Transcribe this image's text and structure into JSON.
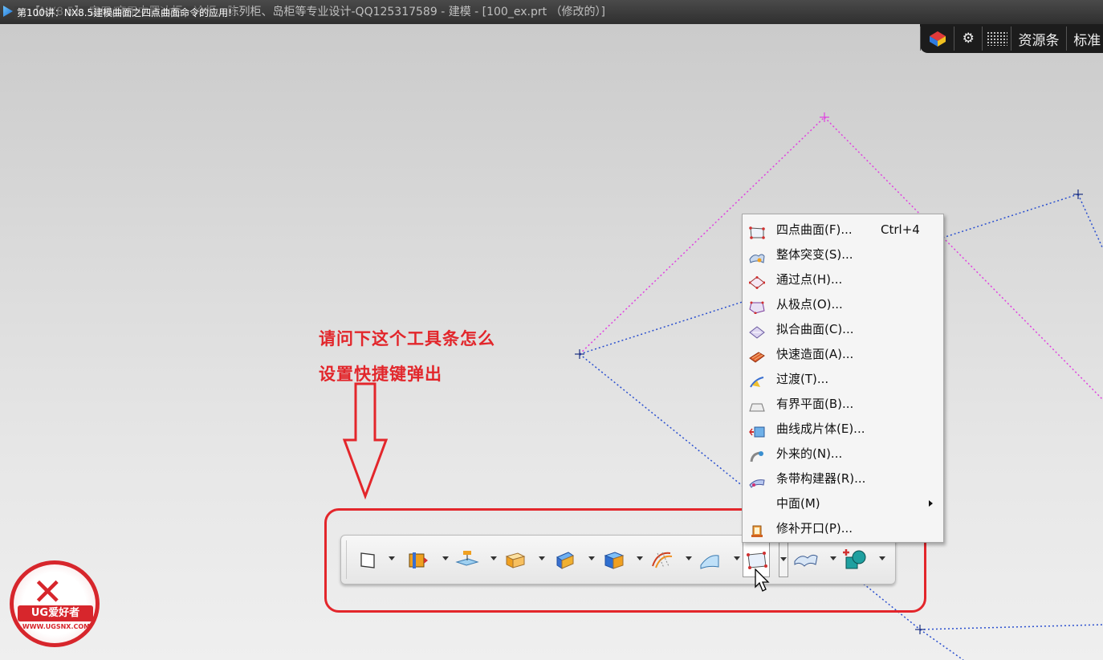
{
  "window": {
    "title": "【NX8.5】 实用/商用中置冰柜、冷柜、陈列柜、岛柜等专业设计-QQ125317589 - 建模 - [100_ex.prt （修改的）]",
    "video_title": "第100讲：NX8.5建模曲面之四点曲面命令的应用!"
  },
  "topbar": {
    "resource_bar_label": "资源条",
    "standard_label": "标准",
    "icons": [
      "cube-icon",
      "gear-icon",
      "grid-icon"
    ]
  },
  "annotation": {
    "line1": "请问下这个工具条怎么",
    "line2": "设置快捷键弹出",
    "color": "#e2262b"
  },
  "toolbar": {
    "tools": [
      "sketch-plane-icon",
      "extrude-icon",
      "datum-plane-icon",
      "box-icon",
      "blend-icon",
      "solid-block-icon",
      "mesh-surface-icon",
      "sweep-surface-icon",
      "four-point-surface-icon",
      "bounded-plane-icon",
      "trim-add-icon"
    ]
  },
  "menu": {
    "items": [
      {
        "label": "四点曲面(F)...",
        "shortcut": "Ctrl+4",
        "icon": "four-point-surface-icon"
      },
      {
        "label": "整体突变(S)...",
        "shortcut": "",
        "icon": "global-shaping-icon"
      },
      {
        "label": "通过点(H)...",
        "shortcut": "",
        "icon": "through-points-icon"
      },
      {
        "label": "从极点(O)...",
        "shortcut": "",
        "icon": "from-poles-icon"
      },
      {
        "label": "拟合曲面(C)...",
        "shortcut": "",
        "icon": "fit-surface-icon"
      },
      {
        "label": "快速造面(A)...",
        "shortcut": "",
        "icon": "rapid-surfacing-icon"
      },
      {
        "label": "过渡(T)...",
        "shortcut": "",
        "icon": "transition-icon"
      },
      {
        "label": "有界平面(B)...",
        "shortcut": "",
        "icon": "bounded-plane-icon"
      },
      {
        "label": "曲线成片体(E)...",
        "shortcut": "",
        "icon": "curves-to-sheet-icon"
      },
      {
        "label": "外来的(N)...",
        "shortcut": "",
        "icon": "foreign-icon"
      },
      {
        "label": "条带构建器(R)...",
        "shortcut": "",
        "icon": "strip-builder-icon"
      },
      {
        "label": "中面(M)",
        "shortcut": "",
        "icon": "",
        "submenu": true
      },
      {
        "label": "修补开口(P)...",
        "shortcut": "",
        "icon": "patch-openings-icon"
      }
    ]
  },
  "logo": {
    "brand_text": "UG爱好者",
    "url_text": "WWW.UGSNX.COM",
    "color": "#d7262c"
  },
  "colors": {
    "magenta_guide": "#e040e0",
    "blue_guide": "#2a4fcf",
    "highlight_red": "#e3262b"
  }
}
